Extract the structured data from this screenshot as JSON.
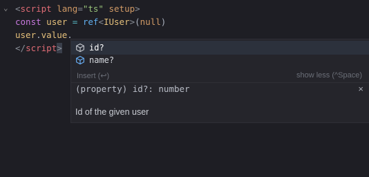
{
  "editor": {
    "lines": [
      {
        "tokens": [
          "<",
          "script",
          " lang",
          "=",
          "\"ts\"",
          " setup",
          ">"
        ]
      },
      {
        "tokens": [
          "const",
          " user",
          " = ",
          "ref",
          "<",
          "IUser",
          ">",
          "(",
          "null",
          ")"
        ]
      },
      {
        "tokens": [
          "user",
          ".",
          "value",
          "."
        ]
      },
      {
        "tokens": [
          "</",
          "script",
          ">"
        ]
      }
    ]
  },
  "suggest": {
    "items": [
      {
        "label": "id?",
        "icon": "property-cube-icon"
      },
      {
        "label": "name?",
        "icon": "property-cube-icon"
      }
    ],
    "insert_label": "Insert (↩)",
    "showless_label": "show less (^Space)",
    "detail": "(property) id?: number",
    "close_icon": "×",
    "documentation": "Id of the given user"
  },
  "colors": {
    "background": "#1e1e24",
    "property_icon": "#6cb6ff"
  }
}
